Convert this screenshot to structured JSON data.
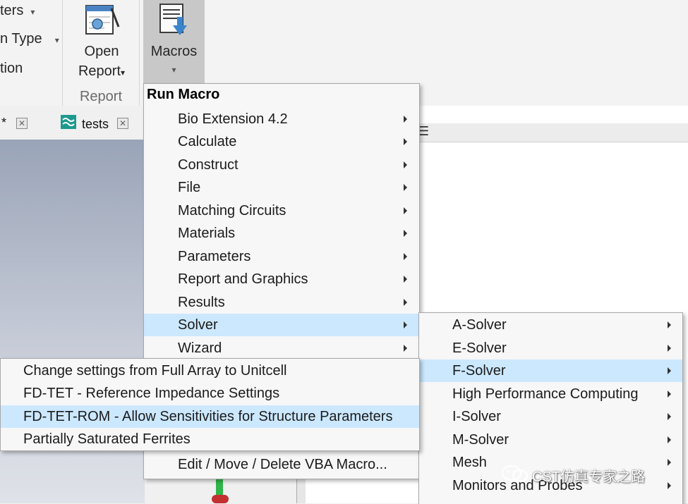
{
  "ribbon": {
    "left_items": [
      {
        "label": "ters",
        "dropdown": true
      },
      {
        "label": "n Type",
        "dropdown": true
      },
      {
        "label": "tion",
        "dropdown": false
      }
    ],
    "open_report": {
      "line1": "Open",
      "line2": "Report",
      "caret": "▾"
    },
    "report_group_title": "Report",
    "macros": {
      "label": "Macros",
      "caret": "▾"
    }
  },
  "tabs": [
    {
      "label": "*"
    },
    {
      "label": "tests"
    }
  ],
  "run_macro_menu": {
    "header": "Run Macro",
    "items": [
      {
        "label": "Bio Extension 4.2",
        "submenu": true
      },
      {
        "label": "Calculate",
        "submenu": true
      },
      {
        "label": "Construct",
        "submenu": true
      },
      {
        "label": "File",
        "submenu": true
      },
      {
        "label": "Matching Circuits",
        "submenu": true
      },
      {
        "label": "Materials",
        "submenu": true
      },
      {
        "label": "Parameters",
        "submenu": true
      },
      {
        "label": "Report and Graphics",
        "submenu": true
      },
      {
        "label": "Results",
        "submenu": true
      },
      {
        "label": "Solver",
        "submenu": true,
        "highlighted": true
      },
      {
        "label": "Wizard",
        "submenu": true
      }
    ],
    "footer_item": "Edit / Move / Delete VBA Macro..."
  },
  "solver_submenu": {
    "items": [
      {
        "label": "A-Solver"
      },
      {
        "label": "E-Solver"
      },
      {
        "label": "F-Solver",
        "highlighted": true
      },
      {
        "label": "High Performance Computing"
      },
      {
        "label": "I-Solver"
      },
      {
        "label": "M-Solver"
      },
      {
        "label": "Mesh"
      },
      {
        "label": "Monitors and Probes"
      }
    ]
  },
  "fsolver_submenu": {
    "items": [
      {
        "label": "Change settings from Full Array to Unitcell"
      },
      {
        "label": "FD-TET - Reference Impedance Settings"
      },
      {
        "label": "FD-TET-ROM - Allow Sensitivities for Structure Parameters",
        "highlighted": true
      },
      {
        "label": "Partially Saturated Ferrites"
      }
    ]
  },
  "watermark": "CST仿真专家之路",
  "colors": {
    "highlight": "#cce8ff",
    "menu_bg": "#f7f7f7",
    "ribbon_bg": "#f3f3f3",
    "macros_pressed": "#c8c8c8"
  }
}
